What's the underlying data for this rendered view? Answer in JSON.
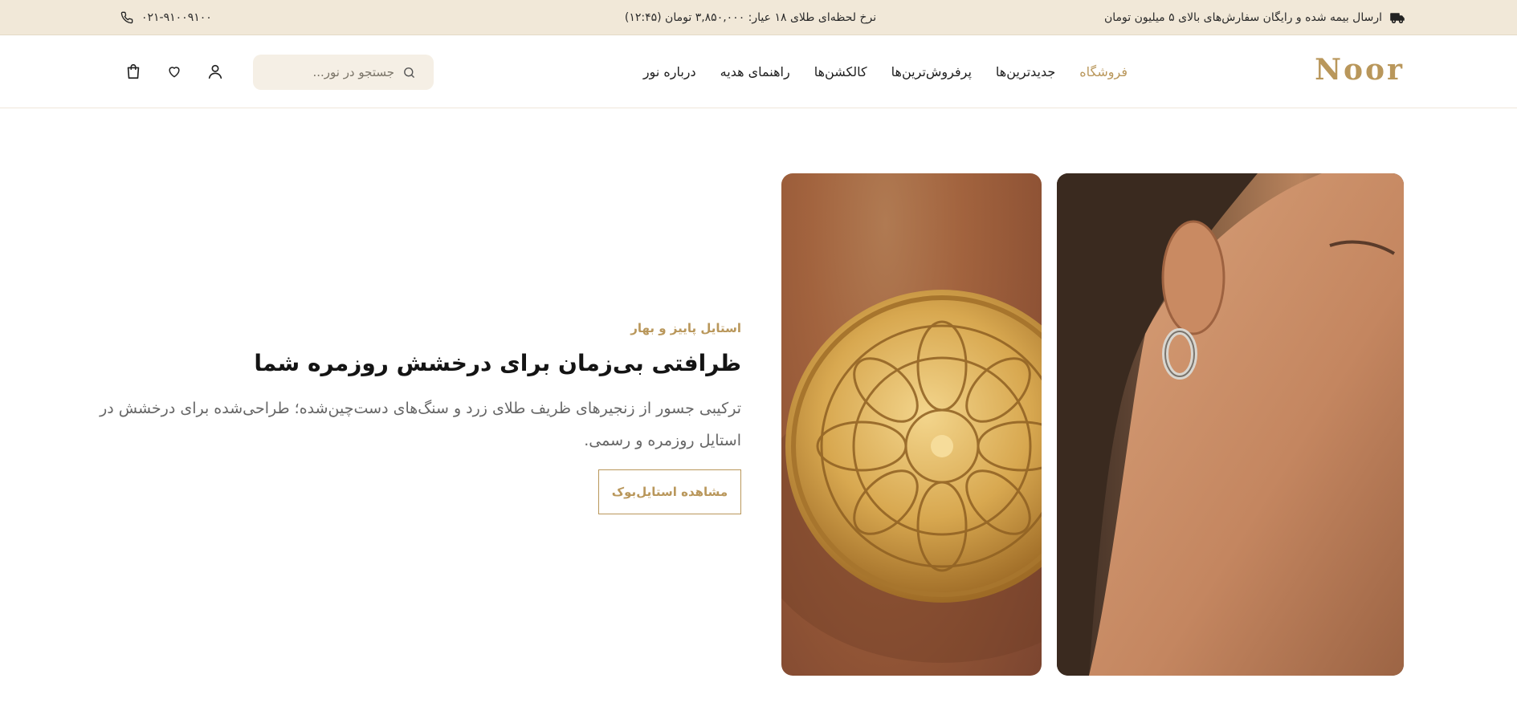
{
  "topbar": {
    "shipping_text": "ارسال بیمه شده و رایگان سفارش‌های بالای ۵ میلیون تومان",
    "gold_rate_text": "نرخ لحظه‌ای طلای ۱۸ عیار: ۳,۸۵۰,۰۰۰ تومان (۱۲:۴۵)",
    "phone": "۰۲۱-۹۱۰۰۹۱۰۰"
  },
  "header": {
    "logo": "Noor",
    "nav": [
      {
        "label": "فروشگاه",
        "active": true
      },
      {
        "label": "جدیدترین‌ها",
        "active": false
      },
      {
        "label": "پرفروش‌ترین‌ها",
        "active": false
      },
      {
        "label": "کالکشن‌ها",
        "active": false
      },
      {
        "label": "راهنمای هدیه",
        "active": false
      },
      {
        "label": "درباره نور",
        "active": false
      }
    ],
    "search_placeholder": "جستجو در نور..."
  },
  "hero": {
    "eyebrow": "استایل پاییز و بهار",
    "headline": "ظرافتی بی‌زمان برای درخشش روزمره شما",
    "description": "ترکیبی جسور از زنجیرهای ظریف طلای زرد و سنگ‌های دست‌چین‌شده؛ طراحی‌شده برای درخشش در استایل روزمره و رسمی.",
    "cta_label": "مشاهده استایل‌بوک"
  },
  "icons": {
    "truck": "truck-icon",
    "phone": "phone-icon",
    "search": "search-icon",
    "user": "user-icon",
    "heart": "heart-icon",
    "bag": "shopping-bag-icon"
  },
  "colors": {
    "accent": "#b9975b",
    "topbar_bg": "#f1e8d8",
    "search_bg": "#f5efe5"
  }
}
